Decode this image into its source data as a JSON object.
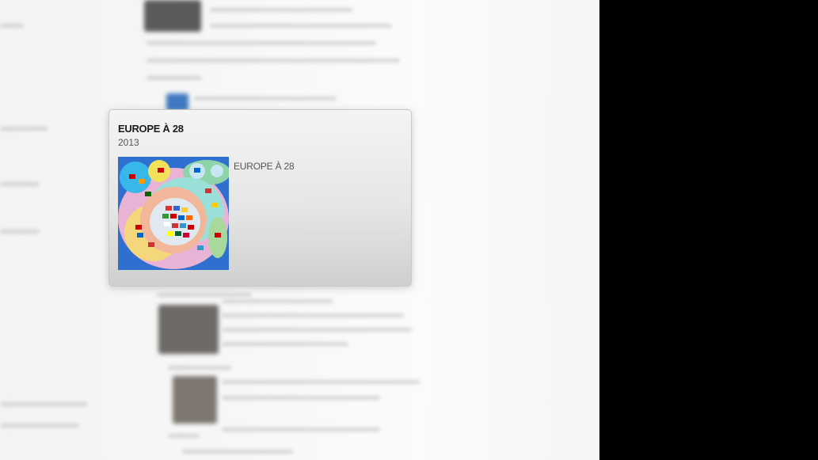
{
  "card": {
    "title": "EUROPE À 28",
    "year": "2013",
    "image_name": "europe-venn-diagram",
    "caption": "EUROPE À 28"
  },
  "colors": {
    "panel": "#000000",
    "card_bg": "#e6e6e6",
    "diagram_bg": "#2f6fcf"
  }
}
